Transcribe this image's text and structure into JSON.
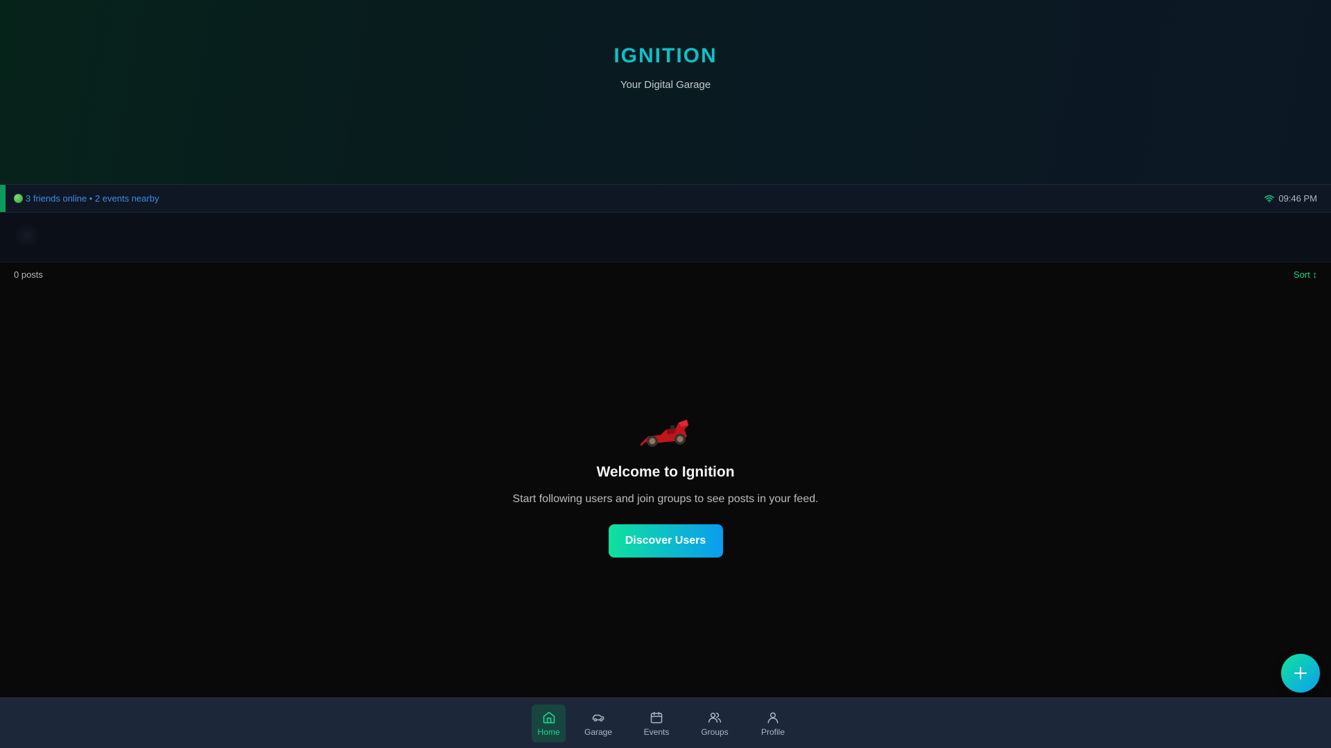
{
  "header": {
    "title": "IGNITION",
    "subtitle": "Your Digital Garage"
  },
  "status": {
    "message": "3 friends online • 2 events nearby",
    "time": "09:46 PM",
    "dot_color": "#3fb83a",
    "wifi_icon": "wifi-icon"
  },
  "feed": {
    "post_count": "0 posts",
    "sort_label": "Sort ↕"
  },
  "empty_state": {
    "icon": "racing-car-icon",
    "title": "Welcome to Ignition",
    "description": "Start following users and join groups to see posts in your feed.",
    "button_label": "Discover Users"
  },
  "fab": {
    "icon": "plus-icon"
  },
  "nav": {
    "items": [
      {
        "label": "Home",
        "icon": "home-icon",
        "active": true
      },
      {
        "label": "Garage",
        "icon": "car-icon",
        "active": false
      },
      {
        "label": "Events",
        "icon": "calendar-icon",
        "active": false
      },
      {
        "label": "Groups",
        "icon": "users-icon",
        "active": false
      },
      {
        "label": "Profile",
        "icon": "user-icon",
        "active": false
      }
    ]
  },
  "colors": {
    "brand": "#10bfc6",
    "accent_green": "#13d68a",
    "accent_blue": "#0a9cf0",
    "link_blue": "#3d8de6"
  }
}
